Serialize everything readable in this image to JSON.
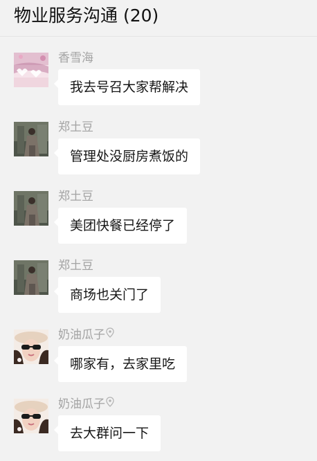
{
  "header": {
    "title": "物业服务沟通 (20)"
  },
  "messages": [
    {
      "sender": "香雪海",
      "text": "我去号召大家帮解决",
      "avatar": "pink-flower-avatar"
    },
    {
      "sender": "郑土豆",
      "text": "管理处没厨房煮饭的",
      "avatar": "woman-standing-photo-avatar"
    },
    {
      "sender": "郑土豆",
      "text": "美团快餐已经停了",
      "avatar": "woman-standing-photo-avatar"
    },
    {
      "sender": "郑土豆",
      "text": "商场也关门了",
      "avatar": "woman-standing-photo-avatar"
    },
    {
      "sender": "奶油瓜子",
      "text": "哪家有，去家里吃",
      "avatar": "woman-sunglasses-hat-avatar"
    },
    {
      "sender": "奶油瓜子",
      "text": "去大群问一下",
      "avatar": "woman-sunglasses-hat-avatar"
    }
  ],
  "colors": {
    "background": "#f2f2f2",
    "bubble": "#ffffff",
    "sender_name": "#a3a3a3",
    "message_text": "#161616"
  }
}
